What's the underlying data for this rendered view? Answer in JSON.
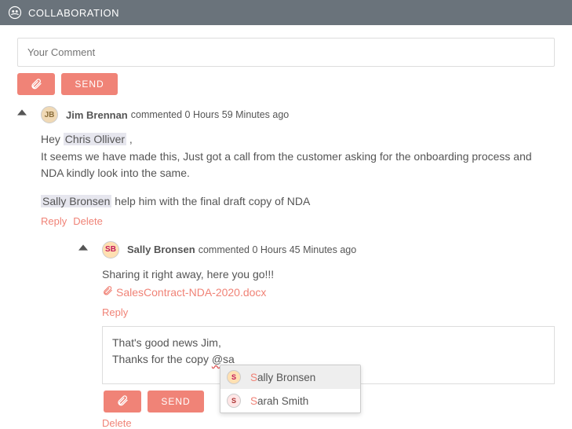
{
  "panel": {
    "title": "COLLABORATION"
  },
  "composer": {
    "placeholder": "Your Comment",
    "send_label": "SEND"
  },
  "comments": {
    "c1": {
      "author": "Jim Brennan",
      "meta": "commented 0 Hours 59 Minutes ago",
      "line1_pre": "Hey ",
      "mention1": "Chris Olliver",
      "line1_post": " ,",
      "line2": "It seems we have made this, Just got a call from the customer asking for the onboarding process and NDA kindly look into the same.",
      "mention2": "Sally Bronsen",
      "line3_post": " help him with the final draft copy of NDA",
      "reply_label": "Reply",
      "delete_label": "Delete"
    },
    "c2": {
      "author": "Sally Bronsen",
      "meta": "commented 0 Hours 45 Minutes ago",
      "line1": "Sharing it right away, here you go!!!",
      "attachment": "SalesContract-NDA-2020.docx",
      "reply_label": "Reply",
      "delete_label": "Delete"
    },
    "editor": {
      "line1": "That's good news Jim,",
      "line2_pre": "Thanks for the copy ",
      "line2_tag": "@sa",
      "send_label": "SEND"
    }
  },
  "suggest": {
    "items": [
      {
        "prefix": "S",
        "rest": "ally Bronsen"
      },
      {
        "prefix": "S",
        "rest": "arah Smith"
      }
    ]
  }
}
